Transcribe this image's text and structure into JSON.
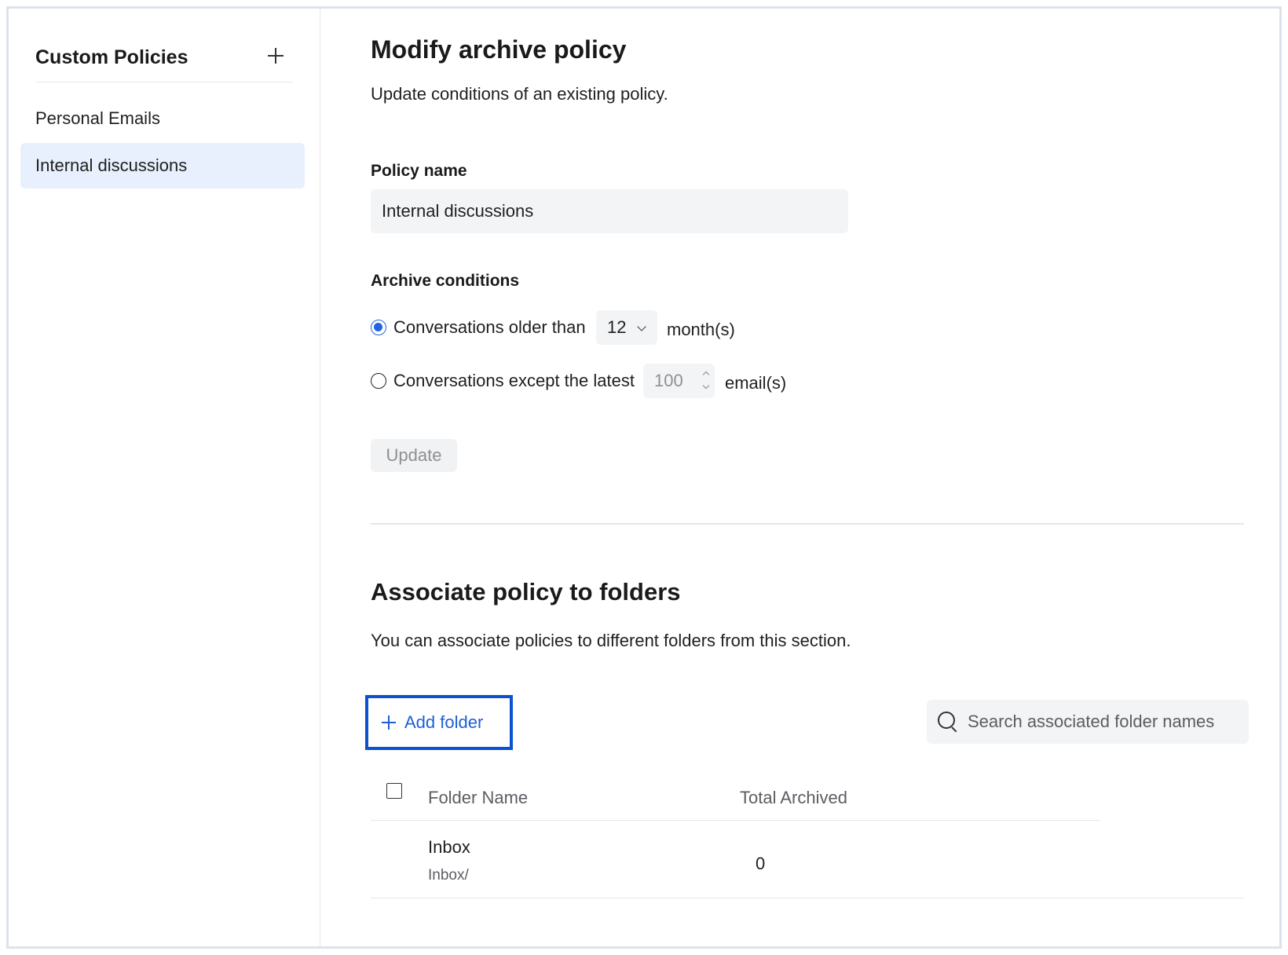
{
  "sidebar": {
    "title": "Custom Policies",
    "items": [
      {
        "label": "Personal Emails",
        "active": false
      },
      {
        "label": "Internal discussions",
        "active": true
      }
    ]
  },
  "main": {
    "title": "Modify archive policy",
    "subtitle": "Update conditions of an existing policy.",
    "policy_name_label": "Policy name",
    "policy_name_value": "Internal discussions",
    "archive_conditions_label": "Archive conditions",
    "condition_older": {
      "label": "Conversations older than",
      "selected": true,
      "select_value": "12",
      "unit": "month(s)"
    },
    "condition_except": {
      "label": "Conversations except the latest",
      "selected": false,
      "number_value": "100",
      "unit": "email(s)"
    },
    "update_button": "Update",
    "associate_title": "Associate policy to folders",
    "associate_subtitle": "You can associate policies to different folders from this section.",
    "add_folder_label": "Add folder",
    "search_placeholder": "Search associated folder names",
    "table": {
      "columns": [
        "Folder Name",
        "Total Archived"
      ],
      "rows": [
        {
          "name": "Inbox",
          "path": "Inbox/",
          "total": "0"
        }
      ]
    }
  },
  "colors": {
    "accent": "#2166e0",
    "highlight_border": "#0b52d1",
    "active_item_bg": "#e8f0fd"
  }
}
